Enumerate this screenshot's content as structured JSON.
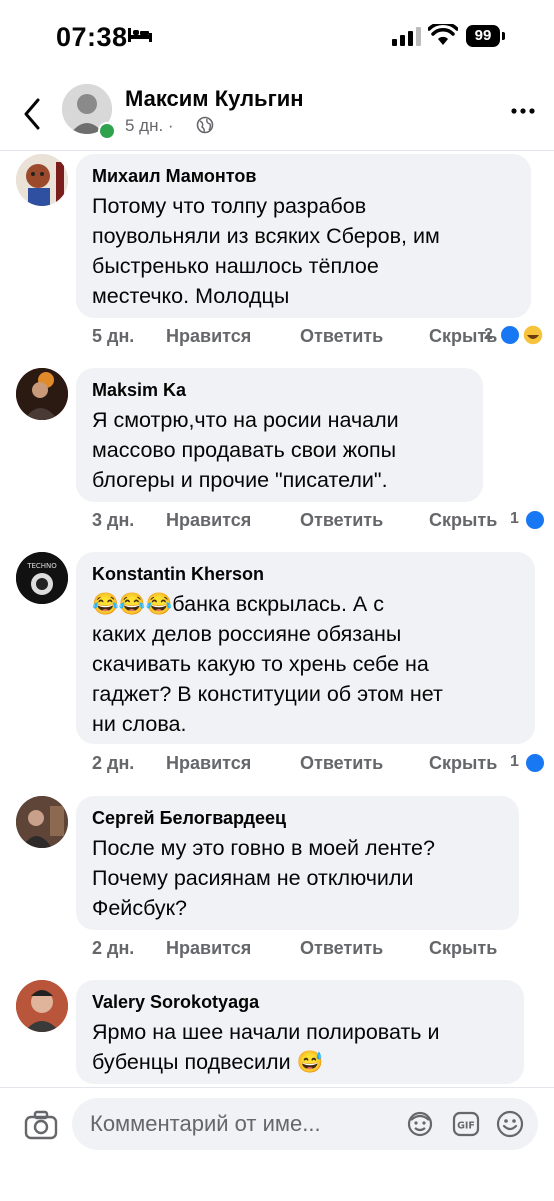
{
  "status_bar": {
    "time": "07:38",
    "battery": "99"
  },
  "header": {
    "name": "Максим Кульгин",
    "meta": "5 дн. ·"
  },
  "comments": [
    {
      "author": "Михаил Мамонтов",
      "text": "Потому что толпу разрабов\nпоувольняли из всяких Сберов, им\nбыстренько нашлось тёплое\nместечко. Молодцы",
      "time": "5 дн.",
      "like": "Нравится",
      "reply": "Ответить",
      "hide": "Скрыть",
      "reactions": "2"
    },
    {
      "author": "Maksim Ka",
      "text": "Я смотрю,что на росии начали\nмассово продавать свои жопы\nблогеры и прочие \"писатели\".",
      "time": "3 дн.",
      "like": "Нравится",
      "reply": "Ответить",
      "hide": "Скрыть",
      "reactions": "1"
    },
    {
      "author": "Konstantin Kherson",
      "text": "😂😂😂банка вскрылась.  А с\nкаких делов россияне обязаны\nскачивать какую то хрень себе на\nгаджет? В конституции об этом нет\nни слова.",
      "time": "2 дн.",
      "like": "Нравится",
      "reply": "Ответить",
      "hide": "Скрыть",
      "reactions": "1"
    },
    {
      "author": "Сергей Белогвардеец",
      "text": "После му это говно в моей ленте?\nПочему расиянам не отключили\nФейсбук?",
      "time": "2 дн.",
      "like": "Нравится",
      "reply": "Ответить",
      "hide": "Скрыть",
      "reactions": ""
    },
    {
      "author": "Valery Sorokotyaga",
      "text": "Ярмо на шее начали полировать и\nбубенцы подвесили 😅",
      "time": "",
      "like": "",
      "reply": "",
      "hide": "",
      "reactions": ""
    }
  ],
  "input": {
    "placeholder": "Комментарий от име..."
  },
  "colors": {
    "bubble": "#f0f2f5",
    "like_blue": "#1877f2",
    "online_green": "#31a24c",
    "meta_gray": "#65676b"
  },
  "icons": [
    "bed-icon",
    "signal-icon",
    "wifi-icon",
    "back-icon",
    "globe-icon",
    "more-icon",
    "like-reaction-icon",
    "haha-reaction-icon",
    "camera-icon",
    "avatar-sticker-icon",
    "gif-icon",
    "emoji-icon"
  ]
}
